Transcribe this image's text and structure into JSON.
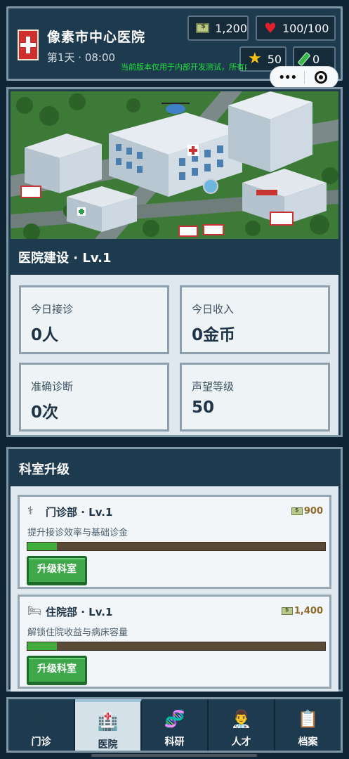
{
  "header": {
    "hospital_name": "像素市中心医院",
    "day_time": "第1天 · 08:00",
    "stats": {
      "cash": "1,200",
      "health": "100/100",
      "stars": "50",
      "research": "0"
    },
    "notice": "当前版本仅用于内部开发测试，所有内容均不面向用户",
    "icons": [
      "hospital-cross-icon",
      "cash-icon",
      "heart-icon",
      "star-icon",
      "test-tube-icon"
    ]
  },
  "capsule": {
    "more": "•••",
    "close_icon": "target-icon"
  },
  "hospital": {
    "title": "医院建设 · Lv.1",
    "stats": [
      {
        "label": "今日接诊",
        "value": "0人"
      },
      {
        "label": "今日收入",
        "value": "0金币"
      },
      {
        "label": "准确诊断",
        "value": "0次"
      },
      {
        "label": "声望等级",
        "value": "50"
      }
    ]
  },
  "departments": {
    "title": "科室升级",
    "items": [
      {
        "icon": "stethoscope-icon",
        "name": "门诊部 · Lv.1",
        "cost": "900",
        "desc": "提升接诊效率与基础诊金",
        "progress": 0.1,
        "button": "升级科室"
      },
      {
        "icon": "bed-icon",
        "name": "住院部 · Lv.1",
        "cost": "1,400",
        "desc": "解锁住院收益与病床容量",
        "progress": 0.1,
        "button": "升级科室"
      }
    ]
  },
  "nav": {
    "items": [
      {
        "label": "门诊",
        "icon": "stethoscope-icon",
        "active": false
      },
      {
        "label": "医院",
        "icon": "hospital-icon",
        "active": true
      },
      {
        "label": "科研",
        "icon": "dna-icon",
        "active": false
      },
      {
        "label": "人才",
        "icon": "doctor-icon",
        "active": false
      },
      {
        "label": "档案",
        "icon": "clipboard-icon",
        "active": false
      }
    ]
  },
  "colors": {
    "background": "#0f2535",
    "panel": "#1e3a4e",
    "border": "#7f96a6",
    "accent_green": "#3fa84a",
    "notice_green": "#1ee23a",
    "health_red": "#e0212b",
    "star_gold": "#f6c21a"
  }
}
